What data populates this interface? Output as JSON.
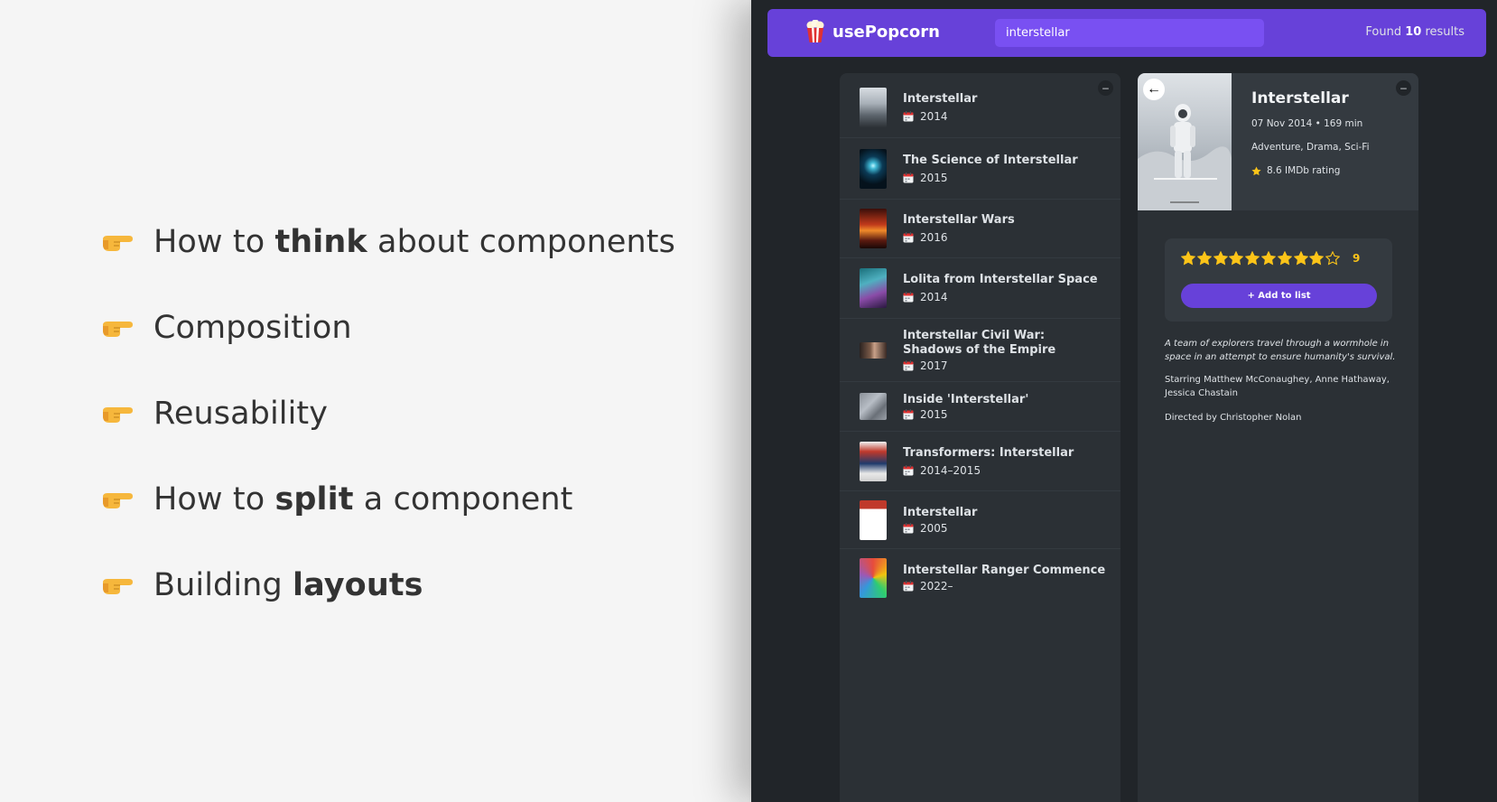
{
  "slide": {
    "bullets": [
      {
        "pre": "How to ",
        "bold": "think",
        "post": " about components"
      },
      {
        "pre": "Composition",
        "bold": "",
        "post": ""
      },
      {
        "pre": "Reusability",
        "bold": "",
        "post": ""
      },
      {
        "pre": "How to ",
        "bold": "split",
        "post": " a component"
      },
      {
        "pre": "Building ",
        "bold": "layouts",
        "post": ""
      }
    ]
  },
  "app": {
    "logo": "usePopcorn",
    "search": {
      "value": "interstellar"
    },
    "results": {
      "prefix": "Found ",
      "count": "10",
      "suffix": " results"
    },
    "colors": {
      "primary": "#6741d9",
      "primary_light": "#7950f2",
      "background": "#212529",
      "box": "#2b3035",
      "star": "#fcc419"
    },
    "movies": [
      {
        "title": "Interstellar",
        "year": "2014"
      },
      {
        "title": "The Science of Interstellar",
        "year": "2015"
      },
      {
        "title": "Interstellar Wars",
        "year": "2016"
      },
      {
        "title": "Lolita from Interstellar Space",
        "year": "2014"
      },
      {
        "title": "Interstellar Civil War: Shadows of the Empire",
        "year": "2017"
      },
      {
        "title": "Inside 'Interstellar'",
        "year": "2015"
      },
      {
        "title": "Transformers: Interstellar",
        "year": "2014–2015"
      },
      {
        "title": "Interstellar",
        "year": "2005"
      },
      {
        "title": "Interstellar Ranger Commence",
        "year": "2022–"
      }
    ],
    "details": {
      "title": "Interstellar",
      "released_runtime": "07 Nov 2014 • 169 min",
      "genre": "Adventure, Drama, Sci-Fi",
      "imdb_rating": "8.6 IMDb rating",
      "stars_max": 10,
      "user_rating": 9,
      "rating_display": "9",
      "add_button": "+ Add to list",
      "plot": "A team of explorers travel through a wormhole in space in an attempt to ensure humanity's survival.",
      "starring": "Starring Matthew McConaughey, Anne Hathaway, Jessica Chastain",
      "director": "Directed by Christopher Nolan"
    }
  }
}
